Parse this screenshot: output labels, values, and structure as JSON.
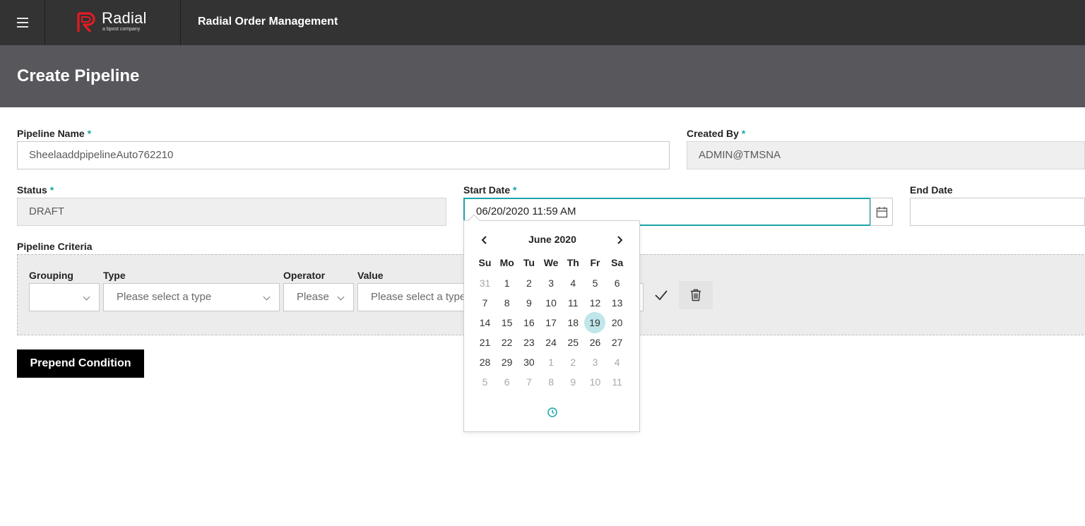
{
  "topbar": {
    "menu_icon": "hamburger-menu-icon",
    "brand_name": "Radial",
    "brand_tagline": "a bpost company",
    "app_title": "Radial Order Management",
    "colors": {
      "bar": "#333333",
      "brand_red": "#e31b23"
    }
  },
  "header": {
    "title": "Create Pipeline"
  },
  "form": {
    "pipeline_name_label": "Pipeline Name",
    "pipeline_name_value": "SheelaaddpipelineAuto762210",
    "created_by_label": "Created By",
    "created_by_value": "ADMIN@TMSNA",
    "status_label": "Status",
    "status_value": "DRAFT",
    "start_date_label": "Start Date",
    "start_date_value": "06/20/2020 11:59 AM",
    "end_date_label": "End Date",
    "end_date_value": "",
    "required_marker": "*"
  },
  "criteria": {
    "section_label": "Pipeline Criteria",
    "columns": {
      "grouping": "Grouping",
      "type": "Type",
      "operator": "Operator",
      "value": "Value"
    },
    "grouping_value": "",
    "type_placeholder": "Please select a type",
    "operator_placeholder": "Please",
    "value_placeholder": "Please select a type",
    "confirm_icon": "check-icon",
    "delete_icon": "trash-icon"
  },
  "buttons": {
    "prepend_condition": "Prepend Condition"
  },
  "datepicker": {
    "month_label": "June 2020",
    "prev_icon": "chevron-left-icon",
    "next_icon": "chevron-right-icon",
    "time_icon": "clock-icon",
    "weekdays": [
      "Su",
      "Mo",
      "Tu",
      "We",
      "Th",
      "Fr",
      "Sa"
    ],
    "weeks": [
      [
        "31",
        "1",
        "2",
        "3",
        "4",
        "5",
        "6"
      ],
      [
        "7",
        "8",
        "9",
        "10",
        "11",
        "12",
        "13"
      ],
      [
        "14",
        "15",
        "16",
        "17",
        "18",
        "19",
        "20"
      ],
      [
        "21",
        "22",
        "23",
        "24",
        "25",
        "26",
        "27"
      ],
      [
        "28",
        "29",
        "30",
        "1",
        "2",
        "3",
        "4"
      ],
      [
        "5",
        "6",
        "7",
        "8",
        "9",
        "10",
        "11"
      ]
    ],
    "highlighted_day": "19",
    "accent_color": "#1aa3a8",
    "highlight_color": "#bfe6ea"
  }
}
